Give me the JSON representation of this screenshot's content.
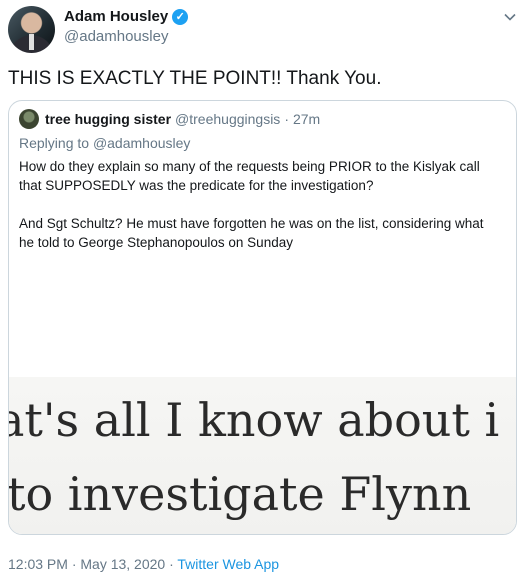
{
  "author": {
    "display_name": "Adam Housley",
    "handle": "@adamhousley",
    "verified": true
  },
  "tweet": {
    "text": "THIS IS EXACTLY THE POINT!! Thank You."
  },
  "quoted": {
    "display_name": "tree hugging sister",
    "handle": "@treehuggingsis",
    "separator": "·",
    "time": "27m",
    "replying_label": "Replying to",
    "replying_to": "@adamhousley",
    "paragraph1": "How do they explain so many of the requests being PRIOR to the Kislyak call that SUPPOSEDLY was the predicate for the investigation?",
    "paragraph2": "And Sgt Schultz? He must have forgotten he was on the list, considering what he told to George Stephanopoulos on Sunday",
    "image_line1": "at's all I know about i",
    "image_line2": "to investigate Flynn"
  },
  "footer": {
    "timestamp": "12:03 PM · May 13, 2020 · ",
    "source": "Twitter Web App"
  }
}
